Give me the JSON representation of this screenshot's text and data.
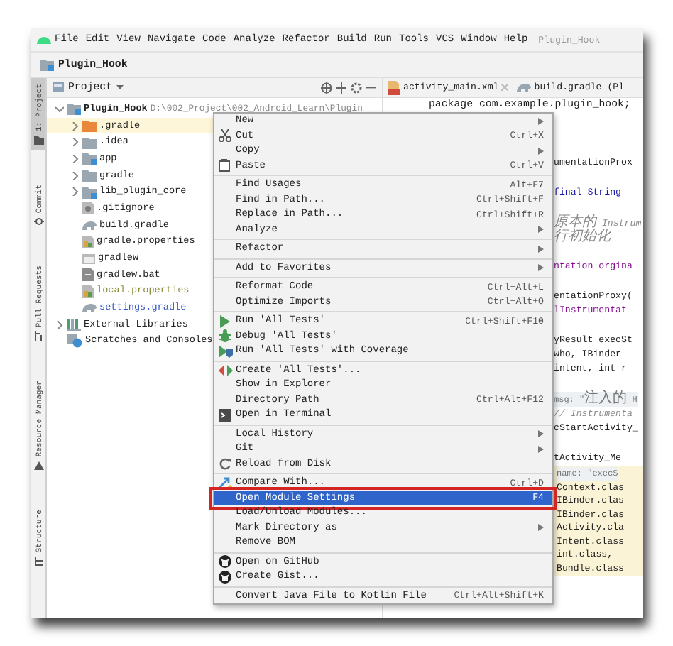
{
  "menu_bar": {
    "items": [
      "File",
      "Edit",
      "View",
      "Navigate",
      "Code",
      "Analyze",
      "Refactor",
      "Build",
      "Run",
      "Tools",
      "VCS",
      "Window",
      "Help"
    ],
    "title": "Plugin_Hook"
  },
  "nav_bar": {
    "crumb": "Plugin_Hook"
  },
  "tool_stripe": [
    {
      "label": "1: Project",
      "selected": true
    },
    {
      "label": "Commit",
      "selected": false
    },
    {
      "label": "Pull Requests",
      "selected": false
    },
    {
      "label": "Resource Manager",
      "selected": false
    },
    {
      "label": "Structure",
      "selected": false
    }
  ],
  "project_panel": {
    "title": "Project",
    "tree": [
      {
        "name": "Plugin_Hook",
        "path": "D:\\002_Project\\002_Android_Learn\\Plugin",
        "kind": "module",
        "expanded": true,
        "selected": false,
        "children": [
          {
            "name": ".gradle",
            "kind": "excluded",
            "expanded": false,
            "selected": true
          },
          {
            "name": ".idea",
            "kind": "folder",
            "expanded": false,
            "selected": false
          },
          {
            "name": "app",
            "kind": "module",
            "expanded": false,
            "selected": false
          },
          {
            "name": "gradle",
            "kind": "folder",
            "expanded": false,
            "selected": false
          },
          {
            "name": "lib_plugin_core",
            "kind": "module",
            "expanded": false,
            "selected": false
          },
          {
            "name": ".gitignore",
            "kind": "ignorefile",
            "selected": false
          },
          {
            "name": "build.gradle",
            "kind": "gradle",
            "selected": false
          },
          {
            "name": "gradle.properties",
            "kind": "properties",
            "selected": false
          },
          {
            "name": "gradlew",
            "kind": "script",
            "selected": false
          },
          {
            "name": "gradlew.bat",
            "kind": "bat",
            "selected": false
          },
          {
            "name": "local.properties",
            "kind": "properties",
            "selected": false,
            "color": "#8c8c3a"
          },
          {
            "name": "settings.gradle",
            "kind": "gradle",
            "selected": false,
            "color": "#3a5bc7"
          }
        ]
      },
      {
        "name": "External Libraries",
        "kind": "library",
        "expanded": false,
        "selected": false
      },
      {
        "name": "Scratches and Consoles",
        "kind": "scratches",
        "selected": false
      }
    ]
  },
  "editor": {
    "tabs": [
      {
        "label": "activity_main.xml",
        "kind": "xml",
        "selected": false,
        "closable": true
      },
      {
        "label": "build.gradle (Pl",
        "kind": "gradle",
        "selected": false,
        "closable": false
      }
    ],
    "package_line": "package com.example.plugin_hook;",
    "blocks": [
      [
        {
          "text": "umentationProx",
          "kind": "code"
        }
      ],
      [
        {
          "text": "final String",
          "kind": "keyword"
        }
      ],
      [
        {
          "text": "原本的 Instrum",
          "kind": "comment"
        },
        {
          "text": "行初始化",
          "kind": "comment"
        }
      ],
      [
        {
          "text": "ntation orgina",
          "kind": "field"
        }
      ],
      [
        {
          "text": "entationProxy(",
          "kind": "code"
        },
        {
          "text": "lInstrumentat",
          "kind": "field"
        }
      ],
      [
        {
          "text": "yResult execSt",
          "kind": "code"
        },
        {
          "text": "who, IBinder",
          "kind": "code"
        },
        {
          "text": "intent, int r",
          "kind": "code"
        }
      ],
      [
        {
          "text": "msg: \"注入的 H",
          "kind": "hint"
        },
        {
          "text": "// Instrumenta",
          "kind": "comment"
        },
        {
          "text": "cStartActivity_",
          "kind": "code"
        }
      ],
      [
        {
          "text": "tActivity_Me",
          "kind": "code"
        }
      ]
    ],
    "popup": [
      {
        "text": "name: \"execS",
        "kind": "hint"
      },
      {
        "text": "Context.clas",
        "kind": "code"
      },
      {
        "text": "IBinder.clas",
        "kind": "code"
      },
      {
        "text": "IBinder.clas",
        "kind": "code"
      },
      {
        "text": "Activity.cla",
        "kind": "code"
      },
      {
        "text": "Intent.class",
        "kind": "code"
      },
      {
        "text": "int.class,",
        "kind": "code"
      },
      {
        "text": "Bundle.class",
        "kind": "code"
      }
    ]
  },
  "context_menu": {
    "groups": [
      [
        {
          "label": "New",
          "submenu": true,
          "selected": false
        },
        {
          "label": "Cut",
          "shortcut": "Ctrl+X",
          "kind": "cut",
          "submenu": false,
          "selected": false
        },
        {
          "label": "Copy",
          "submenu": true,
          "selected": false
        },
        {
          "label": "Paste",
          "shortcut": "Ctrl+V",
          "kind": "paste",
          "submenu": false,
          "selected": false
        }
      ],
      [
        {
          "label": "Find Usages",
          "shortcut": "Alt+F7",
          "submenu": false,
          "selected": false
        },
        {
          "label": "Find in Path...",
          "shortcut": "Ctrl+Shift+F",
          "submenu": false,
          "selected": false
        },
        {
          "label": "Replace in Path...",
          "shortcut": "Ctrl+Shift+R",
          "submenu": false,
          "selected": false
        },
        {
          "label": "Analyze",
          "submenu": true,
          "selected": false
        }
      ],
      [
        {
          "label": "Refactor",
          "submenu": true,
          "selected": false
        }
      ],
      [
        {
          "label": "Add to Favorites",
          "submenu": true,
          "selected": false
        }
      ],
      [
        {
          "label": "Reformat Code",
          "shortcut": "Ctrl+Alt+L",
          "submenu": false,
          "selected": false
        },
        {
          "label": "Optimize Imports",
          "shortcut": "Ctrl+Alt+O",
          "submenu": false,
          "selected": false
        }
      ],
      [
        {
          "label": "Run 'All Tests'",
          "shortcut": "Ctrl+Shift+F10",
          "kind": "run",
          "submenu": false,
          "selected": false
        },
        {
          "label": "Debug 'All Tests'",
          "kind": "debug",
          "submenu": false,
          "selected": false
        },
        {
          "label": "Run 'All Tests' with Coverage",
          "kind": "coverage",
          "submenu": false,
          "selected": false
        }
      ],
      [
        {
          "label": "Create 'All Tests'...",
          "kind": "create",
          "submenu": false,
          "selected": false
        },
        {
          "label": "Show in Explorer",
          "submenu": false,
          "selected": false
        },
        {
          "label": "Directory Path",
          "shortcut": "Ctrl+Alt+F12",
          "submenu": false,
          "selected": false
        },
        {
          "label": "Open in Terminal",
          "kind": "terminal",
          "submenu": false,
          "selected": false
        }
      ],
      [
        {
          "label": "Local History",
          "submenu": true,
          "selected": false
        },
        {
          "label": "Git",
          "submenu": true,
          "selected": false
        },
        {
          "label": "Reload from Disk",
          "kind": "reload",
          "submenu": false,
          "selected": false
        }
      ],
      [
        {
          "label": "Compare With...",
          "shortcut": "Ctrl+D",
          "kind": "compare",
          "submenu": false,
          "selected": false
        },
        {
          "label": "Open Module Settings",
          "shortcut": "F4",
          "submenu": false,
          "selected": true,
          "outlined": true
        },
        {
          "label": "Load/Unload Modules...",
          "submenu": false,
          "selected": false
        },
        {
          "label": "Mark Directory as",
          "submenu": true,
          "selected": false
        },
        {
          "label": "Remove BOM",
          "submenu": false,
          "selected": false
        }
      ],
      [
        {
          "label": "Open on GitHub",
          "kind": "github",
          "submenu": false,
          "selected": false
        },
        {
          "label": "Create Gist...",
          "kind": "github",
          "submenu": false,
          "selected": false
        }
      ],
      [
        {
          "label": "Convert Java File to Kotlin File",
          "shortcut": "Ctrl+Alt+Shift+K",
          "submenu": false,
          "selected": false
        }
      ]
    ]
  }
}
